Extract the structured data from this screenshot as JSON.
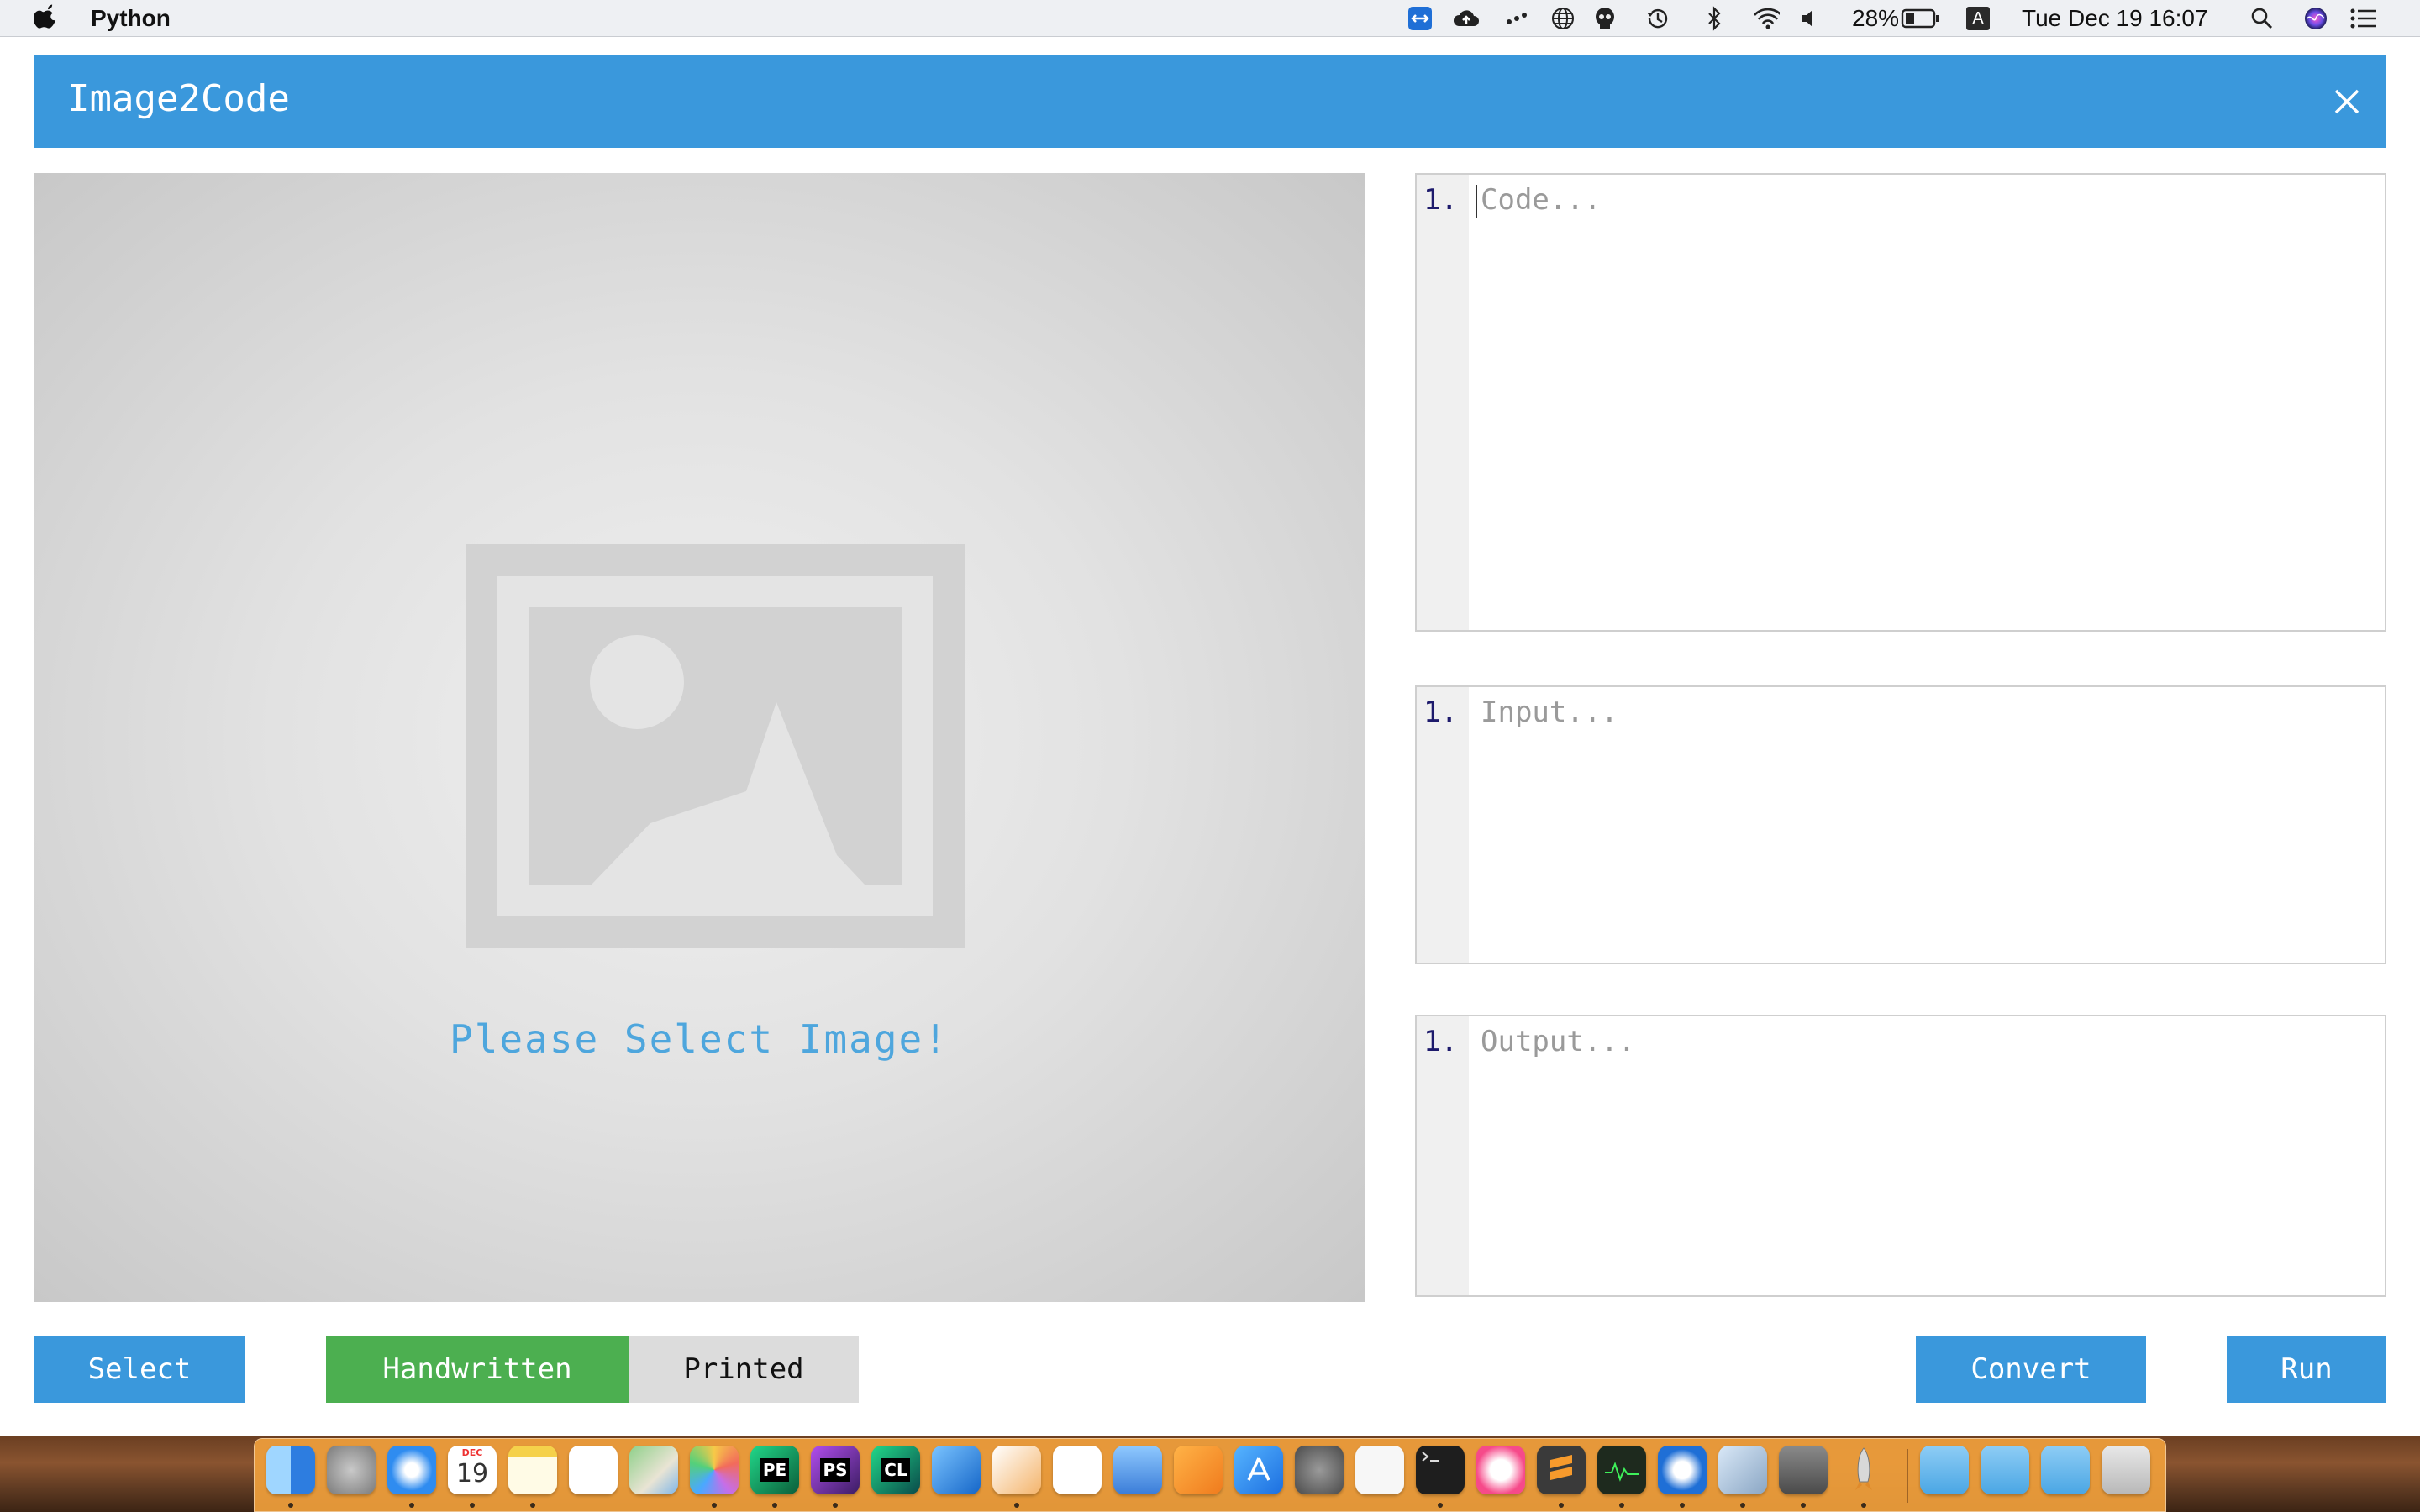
{
  "menubar": {
    "app_name": "Python",
    "battery_percent": "28%",
    "input_source": "A",
    "datetime": "Tue Dec 19  16:07"
  },
  "app": {
    "title": "Image2Code",
    "image_prompt": "Please Select Image!"
  },
  "editors": {
    "code": {
      "line_number": "1.",
      "placeholder": "Code..."
    },
    "input": {
      "line_number": "1.",
      "placeholder": "Input..."
    },
    "output": {
      "line_number": "1.",
      "placeholder": "Output..."
    }
  },
  "buttons": {
    "select": "Select",
    "handwritten": "Handwritten",
    "printed": "Printed",
    "convert": "Convert",
    "run": "Run"
  },
  "mode": {
    "selected": "Handwritten"
  },
  "colors": {
    "header": "#3a98dc",
    "primary_button": "#3a98dc",
    "active_toggle": "#4caf50",
    "inactive_toggle": "#dcdcdc",
    "prompt_text": "#4ea6dd"
  },
  "dock": {
    "calendar_month": "DEC",
    "calendar_day": "19",
    "apps": [
      "finder-icon",
      "launchpad-icon",
      "safari-icon",
      "calendar-icon",
      "notes-icon",
      "reminders-icon",
      "maps-icon",
      "photos-icon",
      "pycharm-edu-icon",
      "phpstorm-icon",
      "clion-icon",
      "xcode-icon",
      "pages-icon",
      "numbers-icon",
      "keynote-icon",
      "ibooks-icon",
      "app-store-icon",
      "system-preferences-icon",
      "textedit-icon",
      "terminal-icon",
      "itunes-icon",
      "sublime-text-icon",
      "activity-monitor-icon",
      "teamviewer-icon",
      "preview-icon",
      "calculator-icon",
      "rocket-icon",
      "downloads-folder-icon",
      "documents-folder-icon",
      "applications-folder-icon",
      "trash-icon"
    ],
    "labels": {
      "pycharm": "PE",
      "phpstorm": "PS",
      "clion": "CL"
    }
  }
}
